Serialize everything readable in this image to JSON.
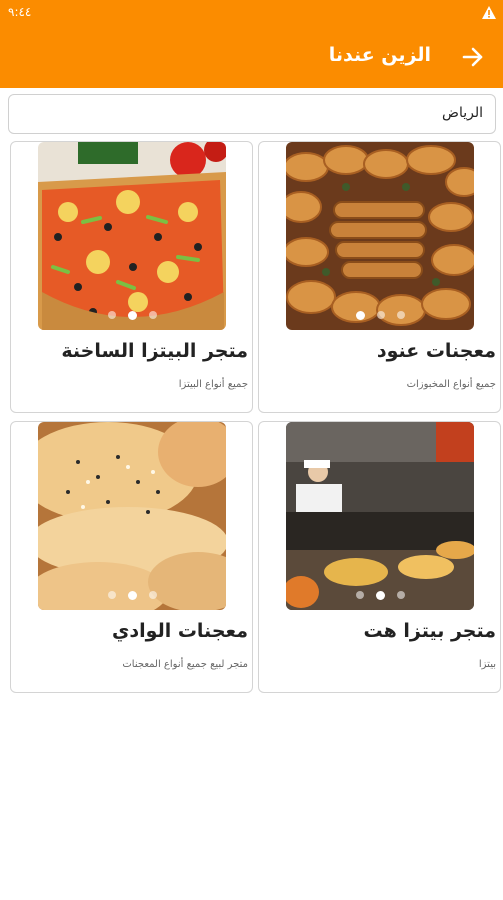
{
  "status": {
    "time": "٩:٤٤"
  },
  "appbar": {
    "title": "الزين عندنا"
  },
  "city": {
    "label": "الرياض"
  },
  "stores": [
    {
      "title": "معجنات عنود",
      "description": "جميع أنواع المخبوزات",
      "image": "pastries-photo"
    },
    {
      "title": "متجر البيتزا الساخنة",
      "description": "جميع أنواع البيتزا",
      "image": "pizza-photo"
    },
    {
      "title": "متجر بيتزا هت",
      "description": "بيتزا",
      "image": "pizza-kitchen-photo"
    },
    {
      "title": "معجنات الوادي",
      "description": "متجر لبيع جميع أنواع المعجنات",
      "image": "bread-photo"
    }
  ],
  "colors": {
    "accent": "#fb8c00"
  }
}
